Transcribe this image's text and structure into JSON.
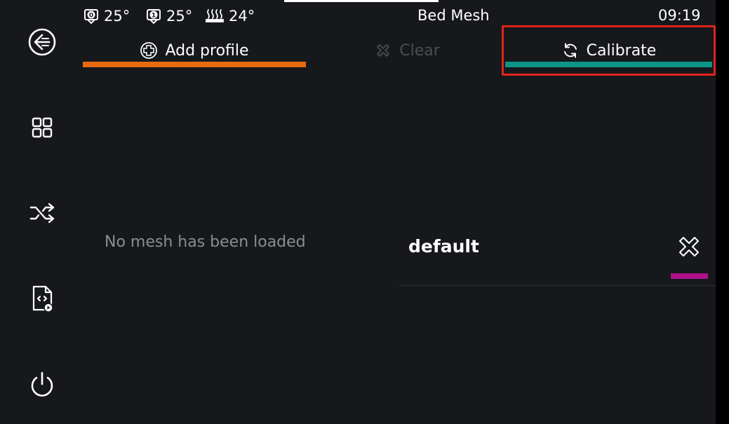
{
  "header": {
    "title": "Bed Mesh",
    "time": "09:19",
    "temps": [
      {
        "icon": "extruder-0-icon",
        "value": "25°"
      },
      {
        "icon": "extruder-1-icon",
        "value": "25°"
      },
      {
        "icon": "heated-bed-icon",
        "value": "24°"
      }
    ]
  },
  "sidebar": {
    "items": [
      {
        "name": "back",
        "icon": "back-arrow-icon"
      },
      {
        "name": "home",
        "icon": "grid-icon"
      },
      {
        "name": "shuffle",
        "icon": "shuffle-icon"
      },
      {
        "name": "macro",
        "icon": "file-script-icon"
      },
      {
        "name": "power",
        "icon": "power-icon"
      }
    ]
  },
  "toolbar": {
    "add_label": "Add profile",
    "clear_label": "Clear",
    "calibrate_label": "Calibrate"
  },
  "main": {
    "empty_message": "No mesh has been loaded"
  },
  "profiles": [
    {
      "name": "default"
    }
  ],
  "colors": {
    "background": "#16181c",
    "add_accent": "#e86a10",
    "calibrate_accent": "#0d9488",
    "delete_accent": "#b0108c",
    "highlight": "#e2231a",
    "disabled_text": "#4a4d52"
  }
}
